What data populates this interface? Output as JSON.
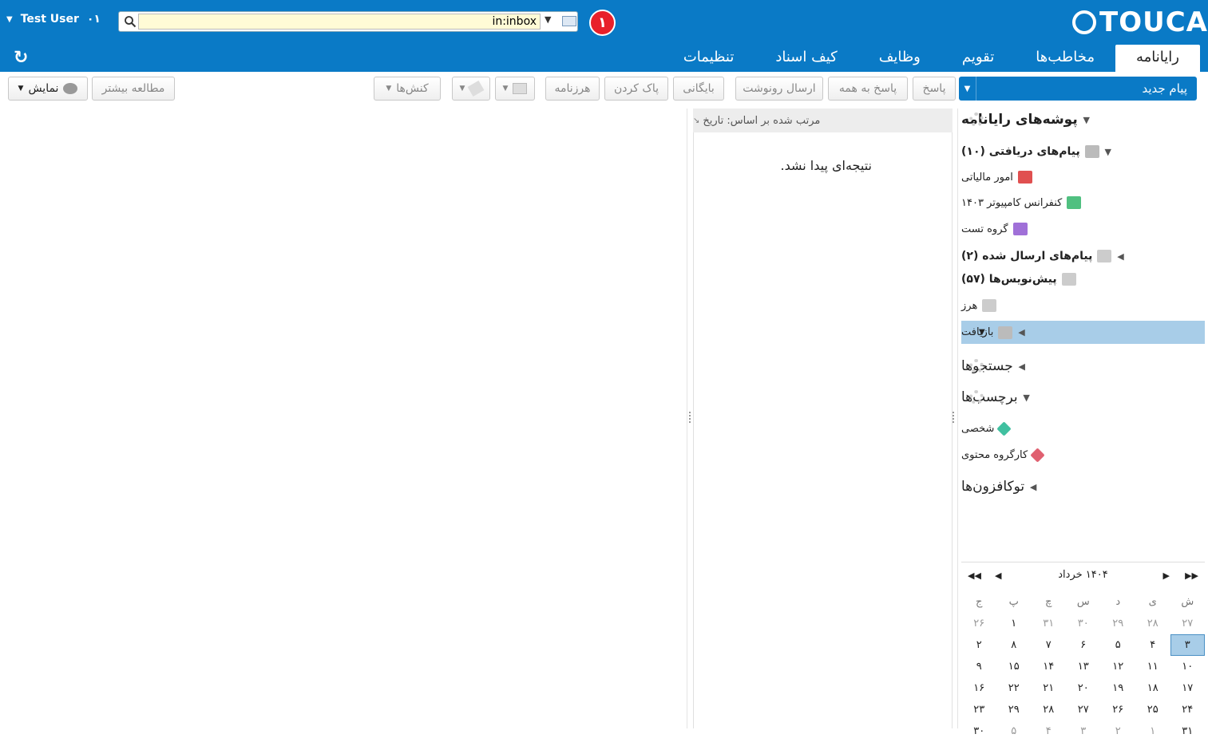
{
  "header": {
    "user_name": "Test User",
    "user_suffix": "۰۱",
    "search_value": "in:inbox",
    "badge_number": "۱",
    "logo_text": "TOUCA",
    "refresh_glyph": "↻",
    "colors": {
      "brand": "#0a7ac6",
      "badge": "#e8202a"
    }
  },
  "tabs": [
    {
      "label": "رایانامه",
      "active": true
    },
    {
      "label": "مخاطب‌ها"
    },
    {
      "label": "تقویم"
    },
    {
      "label": "وظایف"
    },
    {
      "label": "کیف اسناد"
    },
    {
      "label": "تنظیمات"
    }
  ],
  "toolbar": {
    "new_message": "پیام جدید",
    "reply": "پاسخ",
    "reply_all": "پاسخ به همه",
    "forward": "ارسال رونوشت",
    "archive": "بایگانی",
    "delete": "پاک کردن",
    "junk": "هرزنامه",
    "actions": "کنش‌ها",
    "read_more": "مطالعه بیشتر",
    "view": "نمایش"
  },
  "folders": {
    "section_title": "پوشه‌های رایانامه",
    "items": [
      {
        "label": "پیام‌های دریافتی (۱۰)",
        "bold": true,
        "icon": "inbox-icon"
      },
      {
        "label": "امور مالیاتی",
        "icon": "folder-red-icon",
        "color": "#e05050"
      },
      {
        "label": "کنفرانس کامپیوتر ۱۴۰۳",
        "icon": "folder-green-icon",
        "color": "#50c080"
      },
      {
        "label": "گروه تست",
        "icon": "folder-purple-icon",
        "color": "#a070d8"
      },
      {
        "label": "پیام‌های ارسال شده (۲)",
        "bold": true,
        "icon": "sent-icon"
      },
      {
        "label": "پیش‌نویس‌ها (۵۷)",
        "bold": true,
        "icon": "drafts-icon"
      },
      {
        "label": "هرز",
        "icon": "junk-icon"
      },
      {
        "label": "بازیافت",
        "icon": "trash-icon",
        "selected": true
      }
    ],
    "searches_title": "جستجوها",
    "labels_title": "برچسب‌ها",
    "labels": [
      {
        "label": "شخصی",
        "color": "#40c0a0"
      },
      {
        "label": "کارگروه محتوی",
        "color": "#e06070"
      }
    ],
    "addons_title": "توکافزون‌ها"
  },
  "list": {
    "sort_label": "مرتب شده بر اساس: تاریخ",
    "empty_text": "نتیجه‌ای پیدا نشد."
  },
  "calendar": {
    "title": "۱۴۰۴ خرداد",
    "weekdays": [
      "ش",
      "ی",
      "د",
      "س",
      "چ",
      "پ",
      "ج"
    ],
    "rows": [
      [
        "۲۷",
        "۲۸",
        "۲۹",
        "۳۰",
        "۳۱",
        "۱",
        "۲۶"
      ],
      [
        "۳",
        "۴",
        "۵",
        "۶",
        "۷",
        "۸",
        "۲"
      ],
      [
        "۱۰",
        "۱۱",
        "۱۲",
        "۱۳",
        "۱۴",
        "۱۵",
        "۹"
      ],
      [
        "۱۷",
        "۱۸",
        "۱۹",
        "۲۰",
        "۲۱",
        "۲۲",
        "۱۶"
      ],
      [
        "۲۴",
        "۲۵",
        "۲۶",
        "۲۷",
        "۲۸",
        "۲۹",
        "۲۳"
      ],
      [
        "۳۱",
        "۱",
        "۲",
        "۳",
        "۴",
        "۵",
        "۳۰"
      ]
    ]
  }
}
